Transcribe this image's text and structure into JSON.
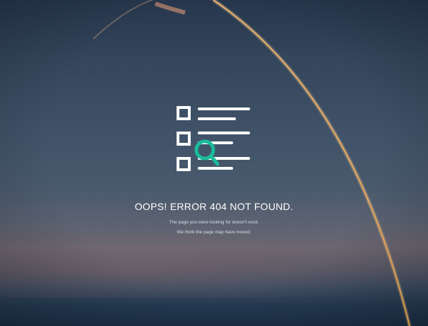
{
  "page": {
    "title": "OOPS! ERROR 404 NOT FOUND.",
    "message_line1": "The page you were looking for doesn't exist.",
    "message_line2": "We think the page may have moved."
  },
  "colors": {
    "accent": "#1abc9c",
    "text": "#ffffff",
    "subtext": "#d7dde5"
  },
  "icons": {
    "illustration": "checklist-search-icon"
  }
}
